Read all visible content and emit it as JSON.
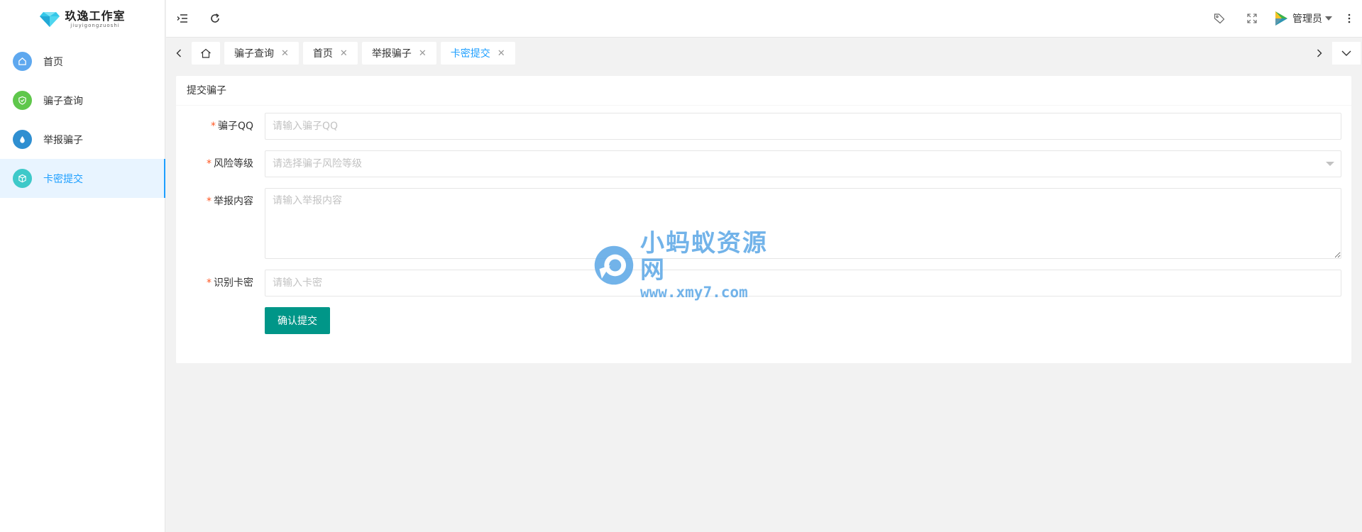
{
  "sidebar": {
    "logo": {
      "title": "玖逸工作室",
      "subtitle": "jiuyigongzuoshi"
    },
    "items": [
      {
        "label": "首页",
        "icon": "home-icon",
        "color": "#5ea8ef"
      },
      {
        "label": "骗子查询",
        "icon": "shield-check-icon",
        "color": "#5fc74b"
      },
      {
        "label": "举报骗子",
        "icon": "drop-icon",
        "color": "#2f8fd1"
      },
      {
        "label": "卡密提交",
        "icon": "cube-icon",
        "color": "#3ec9c9",
        "active": true
      }
    ]
  },
  "header": {
    "user_name": "管理员"
  },
  "tabs": [
    {
      "label": "骗子查询",
      "closable": true
    },
    {
      "label": "首页",
      "closable": true
    },
    {
      "label": "举报骗子",
      "closable": true
    },
    {
      "label": "卡密提交",
      "closable": true,
      "active": true
    }
  ],
  "card": {
    "title": "提交骗子"
  },
  "form": {
    "qq": {
      "label": "骗子QQ",
      "placeholder": "请输入骗子QQ"
    },
    "risk": {
      "label": "风险等级",
      "placeholder": "请选择骗子风险等级"
    },
    "content": {
      "label": "举报内容",
      "placeholder": "请输入举报内容"
    },
    "code": {
      "label": "识别卡密",
      "placeholder": "请输入卡密"
    },
    "submit_label": "确认提交"
  },
  "watermark": {
    "title": "小蚂蚁资源网",
    "url": "www.xmy7.com"
  },
  "colors": {
    "accent": "#1e9fff",
    "primary_button": "#009688",
    "required": "#ff5722"
  }
}
